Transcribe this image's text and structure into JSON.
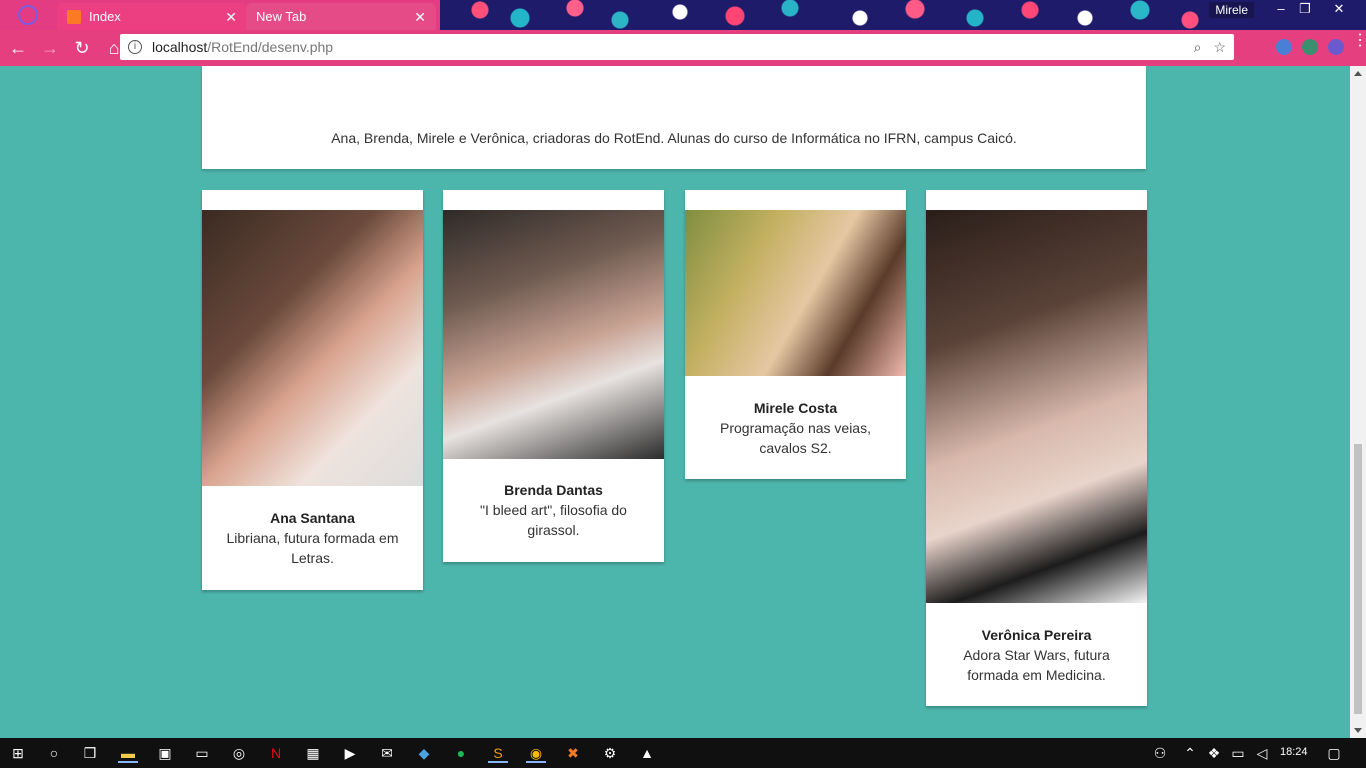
{
  "browser": {
    "tabs": [
      {
        "title": "Index"
      },
      {
        "title": "New Tab"
      }
    ],
    "user_name": "Mirele",
    "url_host": "localhost",
    "url_path": "/RotEnd/desenv.php"
  },
  "page": {
    "intro": "Ana, Brenda, Mirele e Verônica, criadoras do RotEnd. Alunas do curso de Informática no IFRN, campus Caicó.",
    "members": [
      {
        "name": "Ana Santana",
        "description": "Libriana, futura formada em Letras."
      },
      {
        "name": "Brenda Dantas",
        "description": "\"I bleed art\", filosofia do girassol."
      },
      {
        "name": "Mirele Costa",
        "description": "Programação nas veias, cavalos S2."
      },
      {
        "name": "Verônica Pereira",
        "description": "Adora Star Wars, futura formada em Medicina."
      }
    ]
  },
  "taskbar": {
    "time": "18:24"
  },
  "colors": {
    "page_background": "#4db6ac",
    "chrome_accent": "#e63f80"
  },
  "icons": [
    "back-icon",
    "forward-icon",
    "reload-icon",
    "home-icon",
    "info-icon",
    "zoom-icon",
    "star-icon",
    "windows-start-icon",
    "cortana-icon",
    "task-view-icon",
    "file-explorer-icon",
    "store-icon",
    "cmd-icon",
    "netflix-icon",
    "spotify-icon",
    "chrome-icon",
    "xampp-icon",
    "settings-icon",
    "photos-icon",
    "notification-icon"
  ]
}
